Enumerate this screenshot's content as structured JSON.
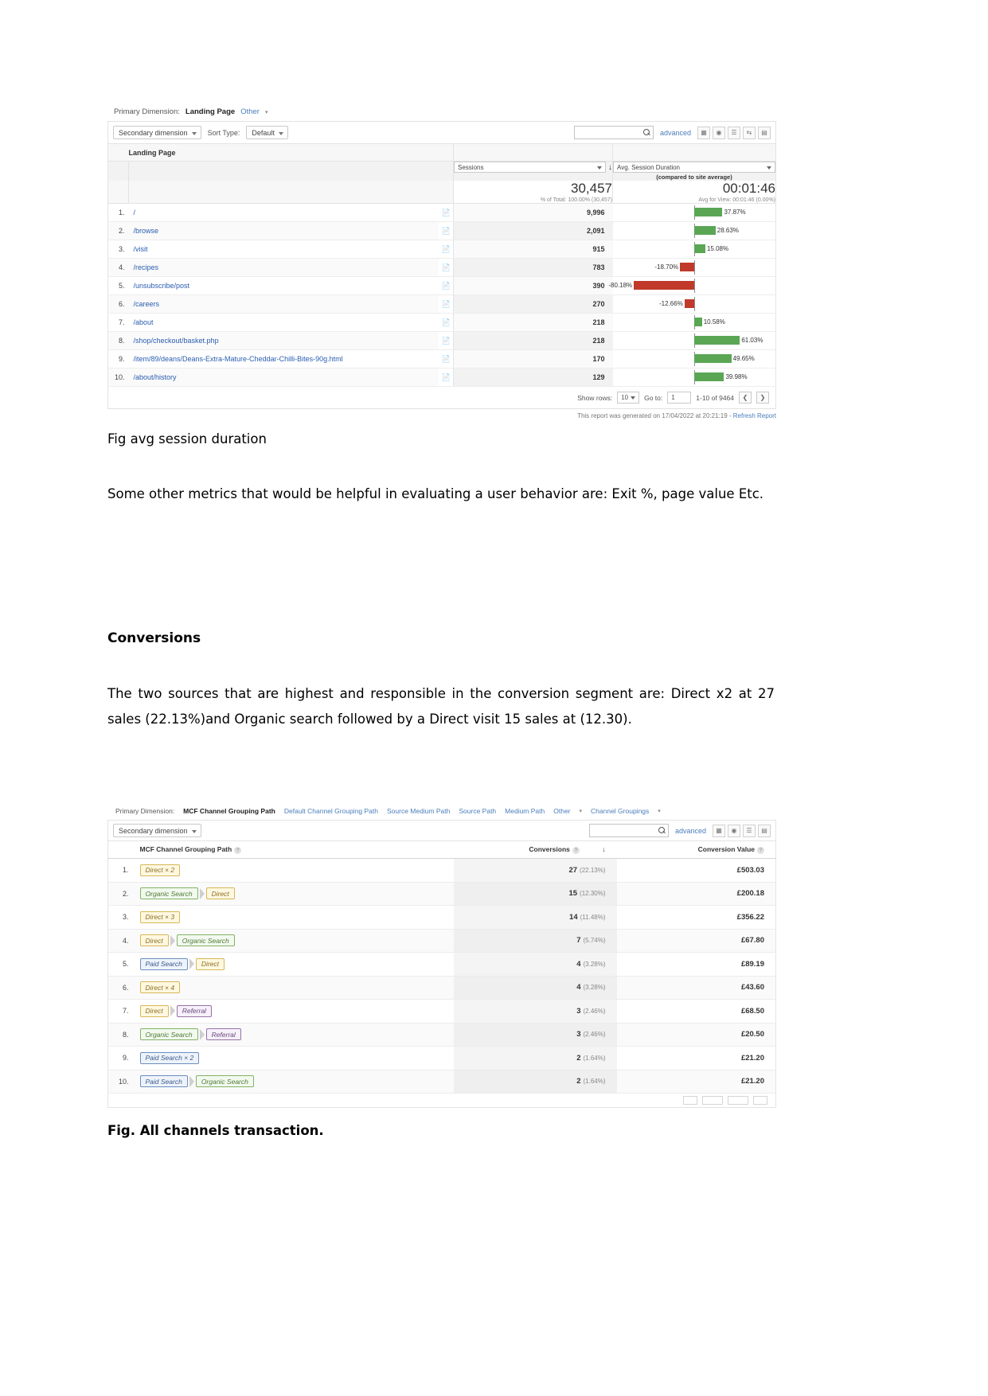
{
  "report1": {
    "primary_dimension_label": "Primary Dimension:",
    "primary_dimension_value": "Landing Page",
    "other_link": "Other",
    "secondary_dimension": "Secondary dimension",
    "sort_type_label": "Sort Type:",
    "sort_type_value": "Default",
    "search_placeholder": "",
    "advanced_link": "advanced",
    "column_header": "Landing Page",
    "metric1_name": "Sessions",
    "metric2_name": "Avg. Session Duration",
    "metric2_sub": "(compared to site average)",
    "total_sessions": "30,457",
    "total_sessions_sub": "% of Total: 100.00% (30,457)",
    "total_duration": "00:01:46",
    "total_duration_sub": "Avg for View: 00:01:46 (0.00%)",
    "rows": [
      {
        "n": "1.",
        "page": "/",
        "sessions": "9,996",
        "pct": "37.87%",
        "sign": "pos"
      },
      {
        "n": "2.",
        "page": "/browse",
        "sessions": "2,091",
        "pct": "28.63%",
        "sign": "pos"
      },
      {
        "n": "3.",
        "page": "/visit",
        "sessions": "915",
        "pct": "15.08%",
        "sign": "pos"
      },
      {
        "n": "4.",
        "page": "/recipes",
        "sessions": "783",
        "pct": "-18.70%",
        "sign": "neg"
      },
      {
        "n": "5.",
        "page": "/unsubscribe/post",
        "sessions": "390",
        "pct": "-80.18%",
        "sign": "neg"
      },
      {
        "n": "6.",
        "page": "/careers",
        "sessions": "270",
        "pct": "-12.66%",
        "sign": "neg"
      },
      {
        "n": "7.",
        "page": "/about",
        "sessions": "218",
        "pct": "10.58%",
        "sign": "pos"
      },
      {
        "n": "8.",
        "page": "/shop/checkout/basket.php",
        "sessions": "218",
        "pct": "61.03%",
        "sign": "pos"
      },
      {
        "n": "9.",
        "page": "/item/89/deans/Deans-Extra-Mature-Cheddar-Chilli-Bites-90g.html",
        "sessions": "170",
        "pct": "49.65%",
        "sign": "pos"
      },
      {
        "n": "10.",
        "page": "/about/history",
        "sessions": "129",
        "pct": "39.98%",
        "sign": "pos"
      }
    ],
    "show_rows_label": "Show rows:",
    "show_rows_value": "10",
    "goto_label": "Go to:",
    "goto_value": "1",
    "range_label": "1-10 of 9464",
    "prev_icon": "❮",
    "next_icon": "❯",
    "generated_text": "This report was generated on 17/04/2022 at 20:21:19 - ",
    "refresh_link": "Refresh Report"
  },
  "caption1": "Fig avg session duration",
  "paragraph1": "Some other metrics that would be helpful in evaluating a user behavior are: Exit %, page value Etc.",
  "heading_conversions": "Conversions",
  "paragraph2": "The two sources that are highest and responsible in the conversion segment are: Direct x2 at 27 sales (22.13%)and Organic search followed by a Direct visit 15 sales at (12.30).",
  "report2": {
    "primary_dimension_label": "Primary Dimension:",
    "primary_dimension_value": "MCF Channel Grouping Path",
    "links": [
      "Default Channel Grouping Path",
      "Source Medium Path",
      "Source Path",
      "Medium Path",
      "Other",
      "Channel Groupings"
    ],
    "secondary_dimension": "Secondary dimension",
    "advanced_link": "advanced",
    "col_path": "MCF Channel Grouping Path",
    "col_conversions": "Conversions",
    "col_value": "Conversion Value",
    "sort_arrow": "↓",
    "rows": [
      {
        "n": "1.",
        "chips": [
          {
            "t": "Direct × 2",
            "c": "yellow"
          }
        ],
        "conv": "27",
        "pct": "(22.13%)",
        "value": "£503.03"
      },
      {
        "n": "2.",
        "chips": [
          {
            "t": "Organic Search",
            "c": "green"
          },
          {
            "t": "Direct",
            "c": "yellow"
          }
        ],
        "conv": "15",
        "pct": "(12.30%)",
        "value": "£200.18"
      },
      {
        "n": "3.",
        "chips": [
          {
            "t": "Direct × 3",
            "c": "yellow"
          }
        ],
        "conv": "14",
        "pct": "(11.48%)",
        "value": "£356.22"
      },
      {
        "n": "4.",
        "chips": [
          {
            "t": "Direct",
            "c": "yellow"
          },
          {
            "t": "Organic Search",
            "c": "green"
          }
        ],
        "conv": "7",
        "pct": "(5.74%)",
        "value": "£67.80"
      },
      {
        "n": "5.",
        "chips": [
          {
            "t": "Paid Search",
            "c": "blue"
          },
          {
            "t": "Direct",
            "c": "yellow"
          }
        ],
        "conv": "4",
        "pct": "(3.28%)",
        "value": "£89.19"
      },
      {
        "n": "6.",
        "chips": [
          {
            "t": "Direct × 4",
            "c": "yellow"
          }
        ],
        "conv": "4",
        "pct": "(3.28%)",
        "value": "£43.60"
      },
      {
        "n": "7.",
        "chips": [
          {
            "t": "Direct",
            "c": "yellow"
          },
          {
            "t": "Referral",
            "c": "purple"
          }
        ],
        "conv": "3",
        "pct": "(2.46%)",
        "value": "£68.50"
      },
      {
        "n": "8.",
        "chips": [
          {
            "t": "Organic Search",
            "c": "green"
          },
          {
            "t": "Referral",
            "c": "purple"
          }
        ],
        "conv": "3",
        "pct": "(2.46%)",
        "value": "£20.50"
      },
      {
        "n": "9.",
        "chips": [
          {
            "t": "Paid Search × 2",
            "c": "blue"
          }
        ],
        "conv": "2",
        "pct": "(1.64%)",
        "value": "£21.20"
      },
      {
        "n": "10.",
        "chips": [
          {
            "t": "Paid Search",
            "c": "blue"
          },
          {
            "t": "Organic Search",
            "c": "green"
          }
        ],
        "conv": "2",
        "pct": "(1.64%)",
        "value": "£21.20"
      }
    ]
  },
  "caption2": "Fig. All channels transaction."
}
